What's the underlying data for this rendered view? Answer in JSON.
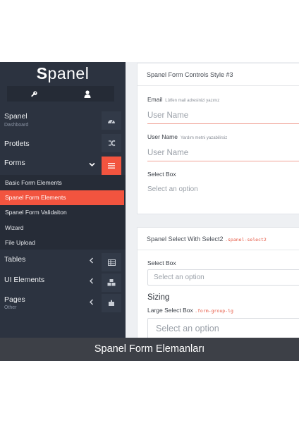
{
  "app": {
    "logo_first": "S",
    "logo_rest": "panel"
  },
  "iconbar": {
    "left_icon": "key-icon",
    "right_icon": "user-icon"
  },
  "sidebar": {
    "spanel": {
      "label": "Spanel",
      "sub": "Dashboard",
      "icon": "dashboard-gauge-icon"
    },
    "protlets": {
      "label": "Protlets",
      "icon": "shuffle-icon"
    },
    "forms": {
      "label": "Forms",
      "icon": "hamburger-menu-icon",
      "chevron": "chevron-down-icon"
    },
    "submenu": [
      {
        "label": "Basic Form Elements"
      },
      {
        "label": "Spanel Form Elements",
        "active": true
      },
      {
        "label": "Spanel Form Validaiton"
      },
      {
        "label": "Wizard"
      },
      {
        "label": "File Upload"
      }
    ],
    "tables": {
      "label": "Tables",
      "icon": "table-icon",
      "chevron": "chevron-left-icon"
    },
    "ui": {
      "label": "UI Elements",
      "icon": "boxes-icon",
      "chevron": "chevron-left-icon"
    },
    "pages": {
      "label": "Pages",
      "sub": "Other",
      "icon": "puzzle-icon",
      "chevron": "chevron-left-icon"
    }
  },
  "panel1": {
    "title": "Spanel Form Controls Style #3",
    "email_label": "Email",
    "email_hint": "Lütfen mail adresinizi yazınız",
    "email_placeholder": "User Name",
    "user_label": "User Name",
    "user_hint": "Yardım metni yazabilirsiz",
    "user_placeholder": "User Name",
    "select_label": "Select Box",
    "select_placeholder": "Select an option"
  },
  "panel2": {
    "title": "Spanel Select With Select2",
    "title_code": ".spanel-select2",
    "select_label": "Select Box",
    "select_placeholder": "Select an option",
    "sizing_title": "Sizing",
    "large_label": "Large Select Box",
    "large_code": ".form-group-lg",
    "large_placeholder": "Select an option"
  },
  "caption": "Spanel Form Elemanları",
  "colors": {
    "accent": "#f2543f",
    "sidebar": "#2c3340",
    "caption_band": "#3d4047"
  }
}
